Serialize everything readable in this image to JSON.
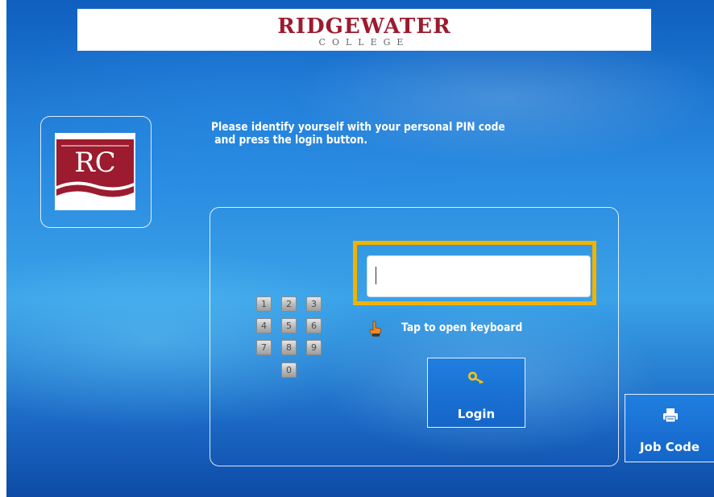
{
  "header": {
    "brand_name": "RIDGEWATER",
    "brand_sub": "COLLEGE"
  },
  "logo": {
    "initials": "RC",
    "colors": {
      "maroon": "#9c1b2e",
      "white": "#ffffff"
    }
  },
  "instruction": {
    "text": "Please identify yourself with your personal PIN code\n and press the login button."
  },
  "pin": {
    "value": "",
    "highlight_color": "#f2b200"
  },
  "keyboard_hint": {
    "label": "Tap to open keyboard",
    "icon": "pointing-hand-icon"
  },
  "keypad": {
    "keys": [
      "1",
      "2",
      "3",
      "4",
      "5",
      "6",
      "7",
      "8",
      "9",
      "0"
    ]
  },
  "buttons": {
    "login": {
      "label": "Login",
      "icon": "key-icon"
    },
    "job_code": {
      "label": "Job Code",
      "icon": "printer-icon"
    }
  },
  "colors": {
    "background": "#2a8be0",
    "button": "#1a72d6",
    "text": "#ffffff"
  }
}
